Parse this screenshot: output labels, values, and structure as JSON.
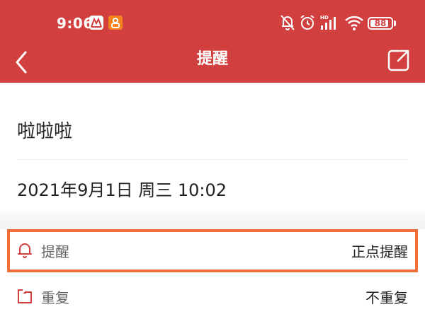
{
  "status_bar": {
    "time": "9:06",
    "battery_level": "88",
    "battery_fraction": 0.88,
    "icons": [
      "app-badge-icon",
      "app-badge-icon",
      "bell-off-icon",
      "alarm-clock-icon",
      "signal-hd-icon",
      "wifi-icon",
      "battery-icon"
    ]
  },
  "nav": {
    "title": "提醒",
    "back_icon": "chevron-left-icon",
    "share_icon": "share-external-icon"
  },
  "event": {
    "title": "啦啦啦",
    "datetime": "2021年9月1日 周三 10:02"
  },
  "settings": [
    {
      "label": "提醒",
      "value": "正点提醒",
      "icon": "bell-icon"
    },
    {
      "label": "重复",
      "value": "不重复",
      "icon": "repeat-icon"
    }
  ],
  "colors": {
    "header_bg": "#d23f3f",
    "accent_red": "#d23f3f",
    "highlight_border": "#ef6e3a"
  }
}
